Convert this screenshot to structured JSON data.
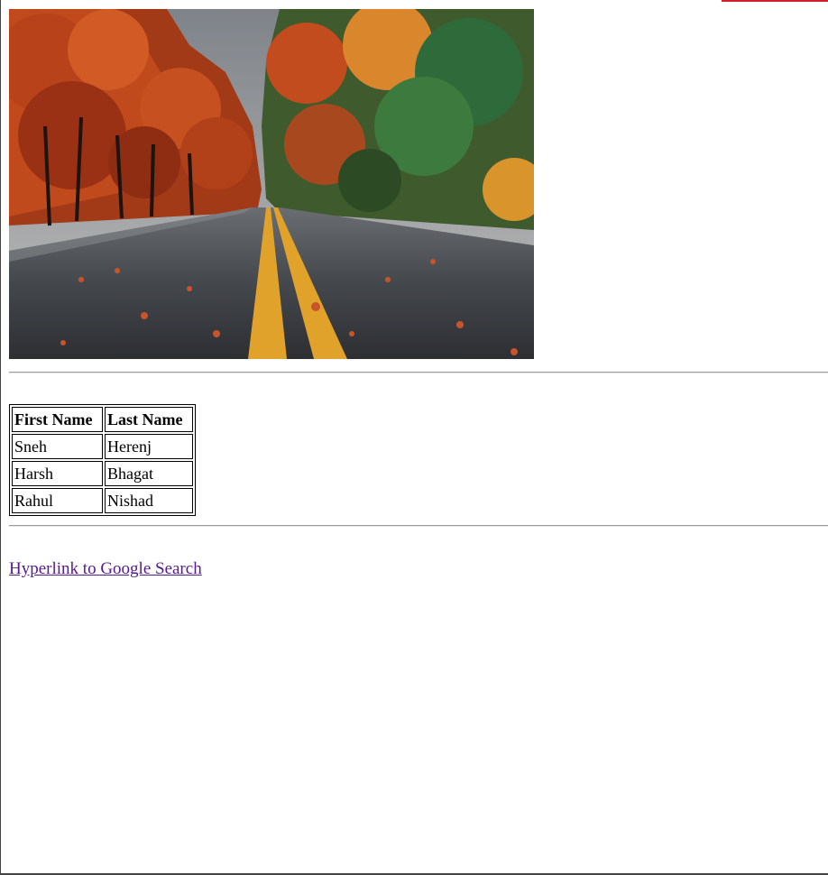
{
  "image": {
    "alt": "Autumn road with red and orange trees"
  },
  "table": {
    "headers": [
      "First Name",
      "Last Name"
    ],
    "rows": [
      [
        "Sneh",
        "Herenj"
      ],
      [
        "Harsh",
        "Bhagat"
      ],
      [
        "Rahul",
        "Nishad"
      ]
    ]
  },
  "link": {
    "label": "Hyperlink to Google Search"
  }
}
